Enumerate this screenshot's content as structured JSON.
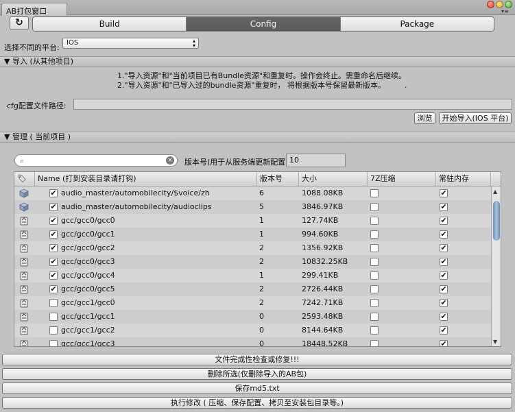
{
  "window": {
    "title": "AB打包窗口"
  },
  "toolbar": {
    "tabs": [
      {
        "label": "Build"
      },
      {
        "label": "Config"
      },
      {
        "label": "Package"
      }
    ]
  },
  "platform": {
    "label": "选择不同的平台:",
    "value": "IOS"
  },
  "import_section": {
    "title": "导入 (从其他项目)",
    "notes": [
      "1.\"导入资源\"和\"当前项目已有Bundle资源\"和重复时。操作会终止。需重命名后继续。",
      "2.\"导入资源\"和\"已导入过的bundle资源\"重复时， 将根据版本号保留最新版本。        ."
    ],
    "cfg_label": "cfg配置文件路径:",
    "cfg_value": "",
    "browse_label": "浏览",
    "start_import_label": "开始导入(IOS 平台)"
  },
  "manage_section": {
    "title": "管理 ( 当前项目 )",
    "search_placeholder": "",
    "version_label": "版本号(用于从服务端更新配置",
    "version_value": "10"
  },
  "table": {
    "columns": [
      "",
      "Name (打到安装目录请打钩)",
      "版本号",
      "大小",
      "7Z压缩",
      "常驻内存"
    ],
    "rows": [
      {
        "icon": "cube-icon",
        "included": true,
        "name": "audio_master/automobilecity/$voice/zh",
        "version": "6",
        "size": "1088.08KB",
        "compress": false,
        "resident": true
      },
      {
        "icon": "cube-icon",
        "included": true,
        "name": "audio_master/automobilecity/audioclips",
        "version": "5",
        "size": "3846.97KB",
        "compress": false,
        "resident": true
      },
      {
        "icon": "file-icon",
        "included": true,
        "name": "gcc/gcc0/gcc0",
        "version": "1",
        "size": "127.74KB",
        "compress": false,
        "resident": true
      },
      {
        "icon": "file-icon",
        "included": true,
        "name": "gcc/gcc0/gcc1",
        "version": "1",
        "size": "994.60KB",
        "compress": false,
        "resident": true
      },
      {
        "icon": "file-icon",
        "included": true,
        "name": "gcc/gcc0/gcc2",
        "version": "2",
        "size": "1356.92KB",
        "compress": false,
        "resident": true
      },
      {
        "icon": "file-icon",
        "included": true,
        "name": "gcc/gcc0/gcc3",
        "version": "2",
        "size": "10832.25KB",
        "compress": false,
        "resident": true
      },
      {
        "icon": "file-icon",
        "included": true,
        "name": "gcc/gcc0/gcc4",
        "version": "1",
        "size": "299.41KB",
        "compress": false,
        "resident": true
      },
      {
        "icon": "file-icon",
        "included": true,
        "name": "gcc/gcc0/gcc5",
        "version": "2",
        "size": "2726.44KB",
        "compress": false,
        "resident": true
      },
      {
        "icon": "file-icon",
        "included": false,
        "name": "gcc/gcc1/gcc0",
        "version": "2",
        "size": "7242.71KB",
        "compress": false,
        "resident": true
      },
      {
        "icon": "file-icon",
        "included": false,
        "name": "gcc/gcc1/gcc1",
        "version": "0",
        "size": "2593.48KB",
        "compress": false,
        "resident": true
      },
      {
        "icon": "file-icon",
        "included": false,
        "name": "gcc/gcc1/gcc2",
        "version": "0",
        "size": "8144.64KB",
        "compress": false,
        "resident": true
      },
      {
        "icon": "file-icon",
        "included": false,
        "name": "gcc/gcc1/gcc3",
        "version": "0",
        "size": "18448.52KB",
        "compress": false,
        "resident": true
      }
    ]
  },
  "actions": {
    "check_label": "文件完成性检查或修复!!!",
    "delete_label": "删除所选(仅删除导入的AB包)",
    "save_md5_label": "保存md5.txt",
    "execute_label": "执行修改 ( 压缩、保存配置、拷贝至安装包目录等。)"
  }
}
